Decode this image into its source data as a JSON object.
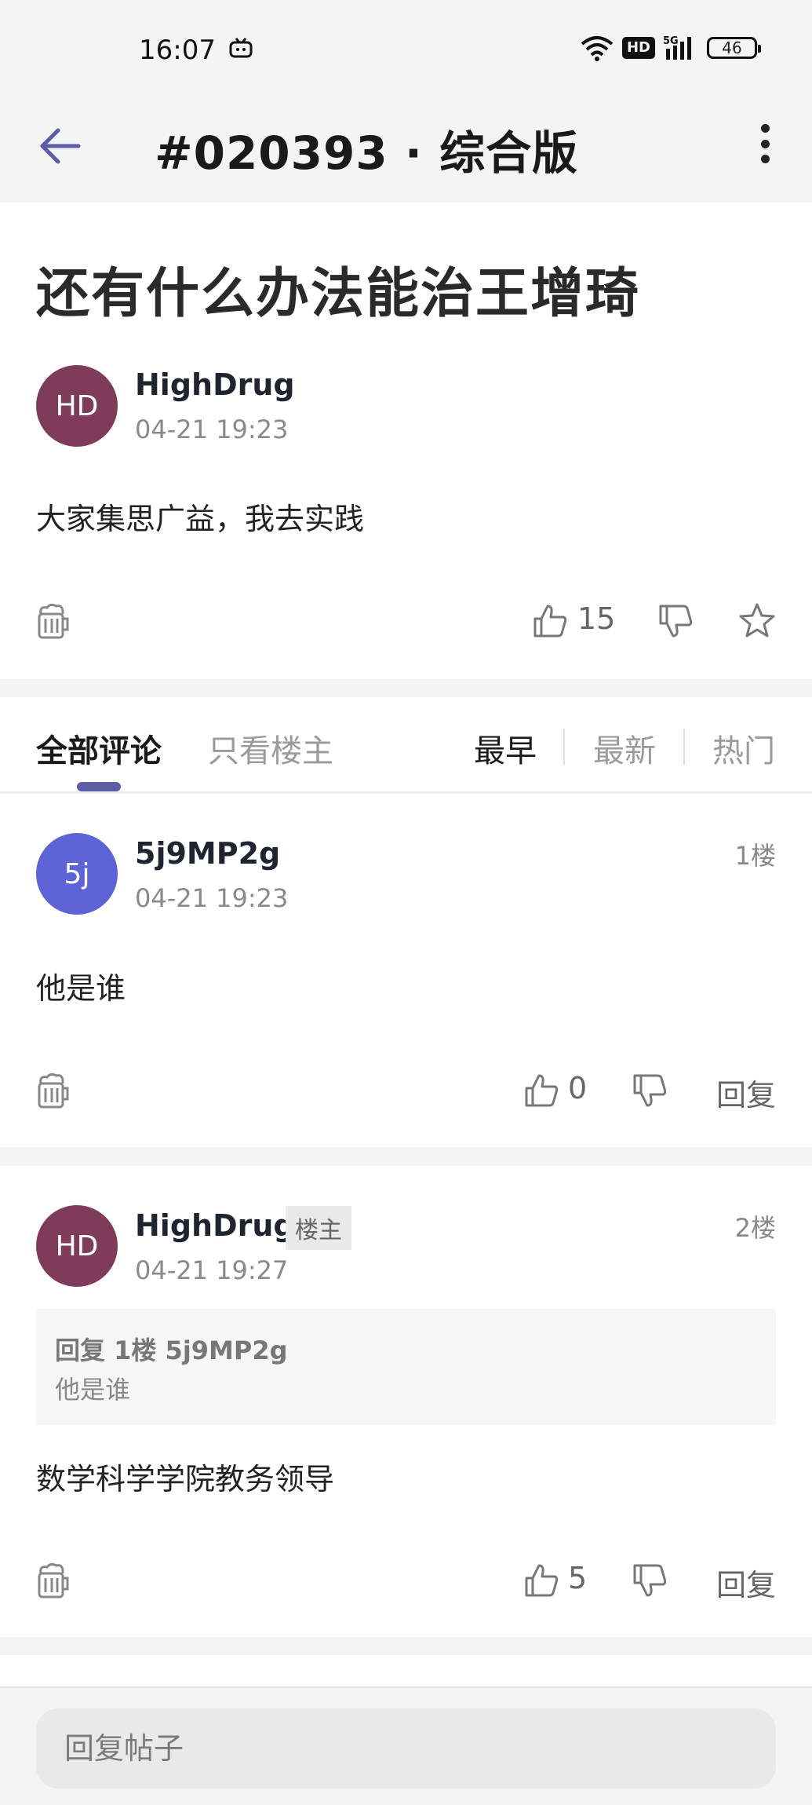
{
  "status_bar": {
    "time": "16:07",
    "network": "5G",
    "hd_label": "HD",
    "battery": "46"
  },
  "header": {
    "title": "#020393 · 综合版",
    "back_icon": "arrow-left-icon",
    "more_icon": "more-vertical-icon",
    "accent_color": "#5b5ea6"
  },
  "post": {
    "title": "还有什么办法能治王增琦",
    "author": {
      "initials": "HD",
      "name": "HighDrug",
      "avatar_color": "#7e3c5a"
    },
    "date": "04-21 19:23",
    "content": "大家集思广益，我去实践",
    "likes": "15"
  },
  "tabs": {
    "all_comments": "全部评论",
    "op_only": "只看楼主",
    "sort": [
      "最早",
      "最新",
      "热门"
    ]
  },
  "comments": [
    {
      "initials": "5j",
      "name": "5j9MP2g",
      "avatar_color": "#5b63d6",
      "date": "04-21 19:23",
      "floor": "1楼",
      "content": "他是谁",
      "likes": "0",
      "reply_label": "回复"
    },
    {
      "initials": "HD",
      "name": "HighDrug",
      "avatar_color": "#7e3c5a",
      "op_tag": "楼主",
      "date": "04-21 19:27",
      "floor": "2楼",
      "quote_header": "回复 1楼 5j9MP2g",
      "quote_text": "他是谁",
      "content": "数学科学学院教务领导",
      "likes": "5",
      "reply_label": "回复"
    }
  ],
  "bottom": {
    "reply_placeholder": "回复帖子"
  }
}
